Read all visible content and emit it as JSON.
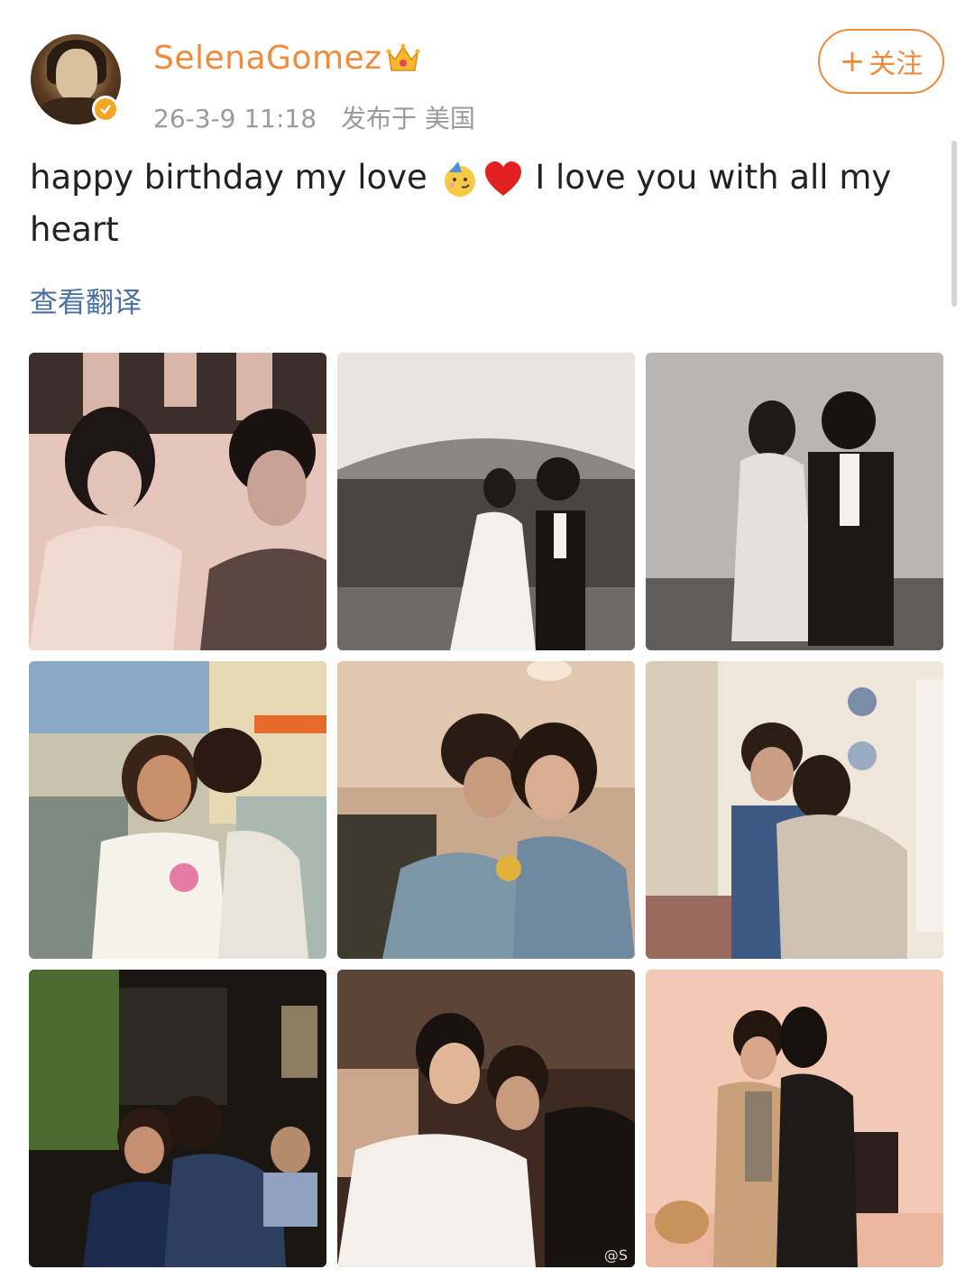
{
  "user": {
    "name": "SelenaGomez",
    "badge_icon": "crown-icon",
    "verified_icon": "verified-badge-icon",
    "timestamp": "26-3-9 11:18",
    "location": "发布于 美国"
  },
  "follow_button": {
    "icon": "plus-icon",
    "label": "关注",
    "plus": "+"
  },
  "post": {
    "text_part1": "happy birthday my love",
    "emojis": [
      "party-face-emoji",
      "red-heart-emoji"
    ],
    "text_part2": "I love you with all my heart",
    "translate_link": "查看翻译"
  },
  "photos": [
    {
      "subject": "couple laughing at dinner table, sepia"
    },
    {
      "subject": "wedding ceremony walk under tent, black and white"
    },
    {
      "subject": "bride and groom walking, black and white"
    },
    {
      "subject": "couple outdoors, kiss on cheek, white dress"
    },
    {
      "subject": "couple selfie at party"
    },
    {
      "subject": "couple hugging in kitchen"
    },
    {
      "subject": "couple kissing at night garden party"
    },
    {
      "subject": "couple posing with white feather dress"
    },
    {
      "subject": "couple kissing in pink room"
    }
  ],
  "watermark": "@S",
  "colors": {
    "accent": "#f08a3d",
    "link": "#4a6fa5",
    "meta": "#9b9b9b"
  }
}
